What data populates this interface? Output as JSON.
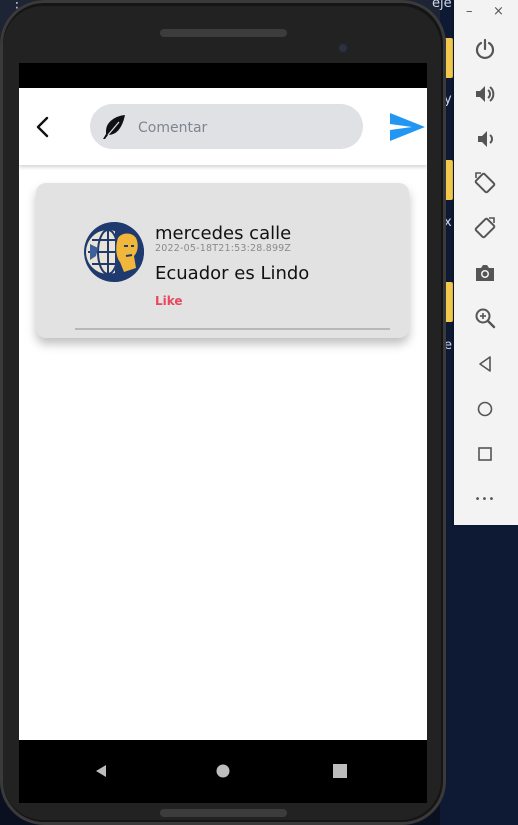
{
  "background": {
    "dots": "⋮",
    "text_top": "eje",
    "text_y": "y",
    "text_x": "x",
    "text_e": "e"
  },
  "emulator_toolbar": {
    "minimize": "–",
    "close": "×",
    "more": "•••"
  },
  "app": {
    "comment_input": {
      "placeholder": "Comentar",
      "value": ""
    },
    "comment": {
      "user": "mercedes calle",
      "timestamp": "2022-05-18T21:53:28.899Z",
      "text": "Ecuador es Lindo",
      "like_label": "Like"
    }
  },
  "colors": {
    "accent_send": "#2196f3",
    "like": "#e8485e",
    "card": "#e2e2e2"
  },
  "icons": [
    "back-arrow-icon",
    "feather-icon",
    "send-icon",
    "power-icon",
    "volume-up-icon",
    "volume-down-icon",
    "rotate-left-icon",
    "rotate-right-icon",
    "camera-icon",
    "zoom-icon",
    "nav-back-icon",
    "nav-home-icon",
    "nav-overview-icon",
    "more-icon"
  ]
}
